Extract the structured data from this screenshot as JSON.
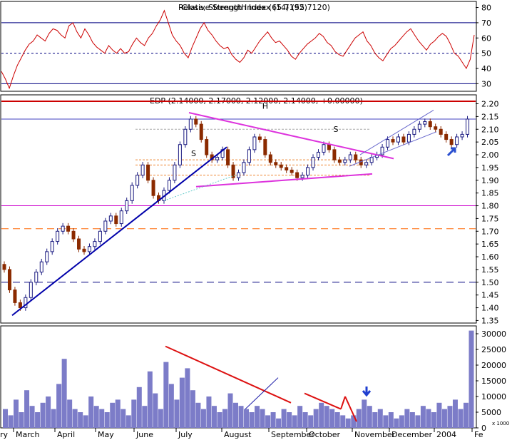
{
  "chart_data": [
    {
      "type": "line",
      "panel": "rsi",
      "title": "Relative Strength Index (14) (55.7120)",
      "title_overlap": "Close, Strength Index (65.7192)",
      "y_ticks": [
        "80",
        "70",
        "60",
        "50",
        "40",
        "30"
      ],
      "ylim": [
        25,
        84
      ],
      "reference_lines": [
        70,
        50,
        30
      ],
      "series": [
        {
          "values": [
            38,
            33,
            27,
            35,
            42,
            47,
            52,
            56,
            58,
            62,
            60,
            58,
            63,
            66,
            65,
            62,
            60,
            68,
            70,
            64,
            60,
            66,
            62,
            57,
            54,
            52,
            50,
            55,
            52,
            50,
            53,
            50,
            51,
            56,
            60,
            57,
            55,
            60,
            63,
            68,
            72,
            78,
            70,
            62,
            58,
            55,
            50,
            47,
            54,
            60,
            66,
            70,
            65,
            62,
            58,
            55,
            53,
            54,
            49,
            46,
            44,
            47,
            52,
            50,
            54,
            58,
            61,
            64,
            60,
            57,
            58,
            55,
            52,
            48,
            46,
            50,
            53,
            56,
            58,
            60,
            63,
            61,
            57,
            55,
            51,
            49,
            48,
            52,
            56,
            60,
            62,
            64,
            58,
            55,
            50,
            47,
            45,
            49,
            53,
            55,
            58,
            61,
            64,
            66,
            62,
            58,
            55,
            52,
            56,
            58,
            61,
            63,
            61,
            56,
            50,
            48,
            44,
            40,
            46,
            62
          ]
        }
      ],
      "colors": {
        "line": "#cc0000",
        "reference": "#000080"
      }
    },
    {
      "type": "candlestick",
      "panel": "price",
      "title": "EDP (2.14000, 2.17000, 2.12000, 2.14000, +0.00000)",
      "y_ticks": [
        "2.20",
        "2.15",
        "2.10",
        "2.05",
        "2.00",
        "1.95",
        "1.90",
        "1.85",
        "1.80",
        "1.75",
        "1.70",
        "1.65",
        "1.60",
        "1.55",
        "1.50",
        "1.45",
        "1.40",
        "1.35"
      ],
      "ylim": [
        1.34,
        2.235
      ],
      "close": [
        1.55,
        1.47,
        1.42,
        1.4,
        1.44,
        1.5,
        1.54,
        1.58,
        1.62,
        1.66,
        1.7,
        1.72,
        1.7,
        1.67,
        1.63,
        1.62,
        1.64,
        1.66,
        1.7,
        1.74,
        1.76,
        1.73,
        1.78,
        1.82,
        1.88,
        1.92,
        1.96,
        1.9,
        1.84,
        1.82,
        1.86,
        1.9,
        1.96,
        2.04,
        2.1,
        2.14,
        2.12,
        2.06,
        2.0,
        1.98,
        1.99,
        2.02,
        1.96,
        1.91,
        1.93,
        1.97,
        2.02,
        2.07,
        2.06,
        2.0,
        1.97,
        1.96,
        1.95,
        1.94,
        1.93,
        1.91,
        1.92,
        1.95,
        1.99,
        2.01,
        2.04,
        2.02,
        1.98,
        1.97,
        1.98,
        2.0,
        1.98,
        1.96,
        1.97,
        1.99,
        2.0,
        2.03,
        2.06,
        2.05,
        2.07,
        2.05,
        2.08,
        2.1,
        2.12,
        2.13,
        2.11,
        2.1,
        2.08,
        2.06,
        2.04,
        2.07,
        2.08,
        2.14
      ],
      "reference_lines": [
        {
          "value": 2.21,
          "color": "#cc0000"
        },
        {
          "value": 2.14,
          "color": "#4040c0"
        },
        {
          "value": 1.8,
          "color": "#cc00cc"
        },
        {
          "value": 1.71,
          "color": "#ff6600",
          "dash": "long"
        },
        {
          "value": 1.5,
          "color": "#000080",
          "dash": "long"
        }
      ],
      "annotations": [
        {
          "text": "S",
          "x": 0.4,
          "y": 1.995
        },
        {
          "text": "H",
          "x": 0.55,
          "y": 2.18
        },
        {
          "text": "S",
          "x": 0.7,
          "y": 2.09
        }
      ],
      "colors": {
        "up": "#1a1a80",
        "down": "#8b2a00",
        "trend": "#0000aa",
        "triangle": "#dd33dd",
        "channel": "#6666cc",
        "arrow": "#2a4fd0"
      }
    },
    {
      "type": "bar",
      "panel": "volume",
      "unit_label": "x 1000",
      "y_ticks": [
        "30000",
        "25000",
        "20000",
        "15000",
        "10000",
        "5000",
        "0"
      ],
      "ylim": [
        0,
        32500
      ],
      "categories": [
        "March",
        "April",
        "May",
        "June",
        "July",
        "August",
        "September",
        "October",
        "November",
        "December",
        "2004",
        "Fe"
      ],
      "partial_left_label": "ry",
      "values": [
        6000,
        4000,
        9000,
        5000,
        12000,
        7000,
        5000,
        8000,
        10000,
        6000,
        14000,
        22000,
        9000,
        6000,
        5000,
        4000,
        10000,
        7000,
        6000,
        5000,
        8000,
        9000,
        6000,
        4000,
        9000,
        13000,
        7000,
        18000,
        11000,
        6000,
        21000,
        14000,
        9000,
        16000,
        19000,
        12000,
        8000,
        6000,
        10000,
        7000,
        5000,
        6000,
        11000,
        8000,
        7000,
        6000,
        5000,
        7000,
        6000,
        4000,
        5000,
        3000,
        6000,
        5000,
        4000,
        7000,
        5000,
        4000,
        6000,
        8000,
        7000,
        6000,
        5000,
        4000,
        3000,
        4000,
        6000,
        9000,
        7000,
        5000,
        6000,
        4000,
        5000,
        3000,
        4000,
        6000,
        5000,
        4000,
        7000,
        6000,
        5000,
        8000,
        6000,
        7000,
        9000,
        6000,
        8000,
        31000
      ],
      "colors": {
        "bar": "#7c7cc8",
        "trend": "#dd1111",
        "arrow": "#1f3fd0"
      }
    }
  ]
}
